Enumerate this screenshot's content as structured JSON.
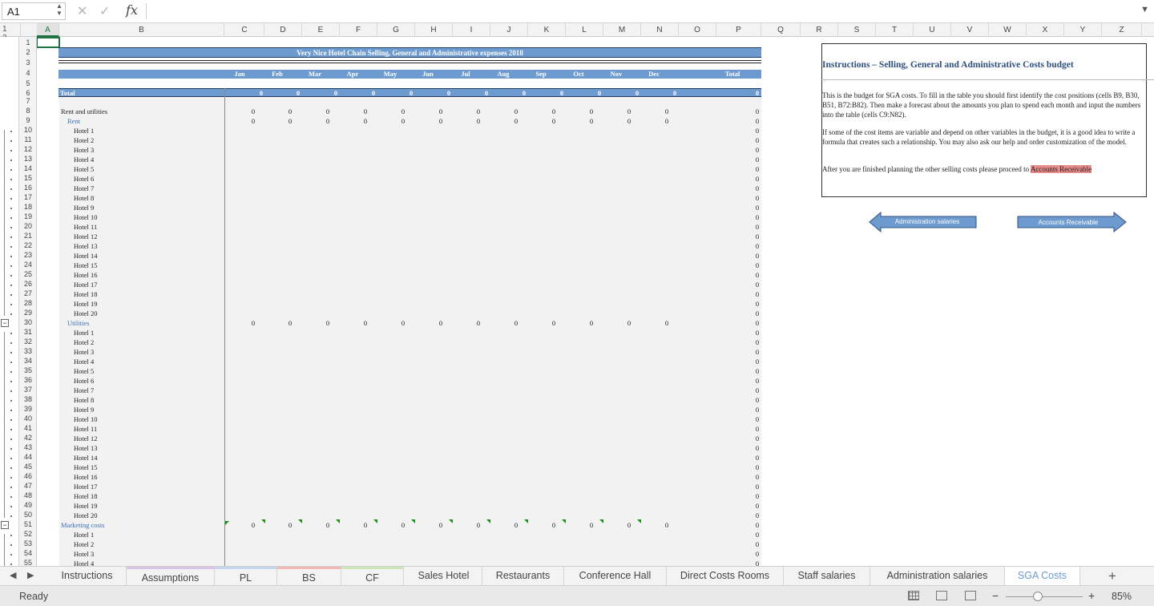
{
  "formula_bar": {
    "name_box": "A1",
    "fx_label": "fx",
    "formula": ""
  },
  "outline_levels": "1 2",
  "columns": [
    "A",
    "B",
    "C",
    "D",
    "E",
    "F",
    "G",
    "H",
    "I",
    "J",
    "K",
    "L",
    "M",
    "N",
    "O",
    "P",
    "Q",
    "R",
    "S",
    "T",
    "U",
    "V",
    "W",
    "X",
    "Y",
    "Z"
  ],
  "rows": [
    "1",
    "2",
    "3",
    "4",
    "5",
    "6",
    "7",
    "8",
    "9",
    "10",
    "11",
    "12",
    "13",
    "14",
    "15",
    "16",
    "17",
    "18",
    "19",
    "20",
    "21",
    "22",
    "23",
    "24",
    "25",
    "26",
    "27",
    "28",
    "29",
    "30",
    "31",
    "32",
    "33",
    "34",
    "35",
    "36",
    "37",
    "38",
    "39",
    "40",
    "41",
    "42",
    "43",
    "44",
    "45",
    "46",
    "47",
    "48",
    "49",
    "50",
    "51",
    "52",
    "53",
    "54",
    "55"
  ],
  "sheet": {
    "title": "Very Nice Hotel Chain Selling, General and Administrative expenses 2018",
    "months": [
      "Jan",
      "Feb",
      "Mar",
      "Apr",
      "May",
      "Jun",
      "Jul",
      "Aug",
      "Sep",
      "Oct",
      "Nov",
      "Dec",
      "Total"
    ],
    "total_label": "Total",
    "zero": "0",
    "labels": {
      "rent_utilities": "Rent and utilities",
      "rent": "Rent",
      "utilities": "Utilities",
      "marketing": "Marketing costs"
    },
    "hotels": [
      "Hotel 1",
      "Hotel 2",
      "Hotel 3",
      "Hotel 4",
      "Hotel 5",
      "Hotel 6",
      "Hotel 7",
      "Hotel 8",
      "Hotel 9",
      "Hotel 10",
      "Hotel 11",
      "Hotel 12",
      "Hotel 13",
      "Hotel 14",
      "Hotel 15",
      "Hotel 16",
      "Hotel 17",
      "Hotel 18",
      "Hotel 19",
      "Hotel 20"
    ]
  },
  "instructions": {
    "title": "Instructions – Selling, General and Administrative Costs budget",
    "p1": "This is the budget for SGA costs. To fill in the table you should first identify the cost positions (cells B9, B30, B51, B72:B82). Then make a forecast about the amounts you plan to spend each month and input the numbers into the table (cells C9:N82).",
    "p2": "If some of the cost items are variable and depend on other variables in the budget, it is a good idea to write a formula that creates such a relationship. You may also ask our help and order customization of the model.",
    "p3_before": "After you are finished planning the other selling costs please proceed to ",
    "p3_link": "Accounts Receivable"
  },
  "nav": {
    "back": "Administration salaries",
    "forward": "Accounts Receivable"
  },
  "tabs": [
    "Instructions",
    "Assumptions",
    "PL",
    "BS",
    "CF",
    "Sales Hotel",
    "Restaurants",
    "Conference Hall",
    "Direct Costs Rooms",
    "Staff salaries",
    "Administration salaries",
    "SGA Costs"
  ],
  "active_tab": "SGA Costs",
  "tab_colors": {
    "Assumptions": "#d9c6e6",
    "PL": "#c6d6ee",
    "BS": "#f2b8b8",
    "CF": "#cfe6b8"
  },
  "status": {
    "text": "Ready",
    "zoom": "85%"
  }
}
